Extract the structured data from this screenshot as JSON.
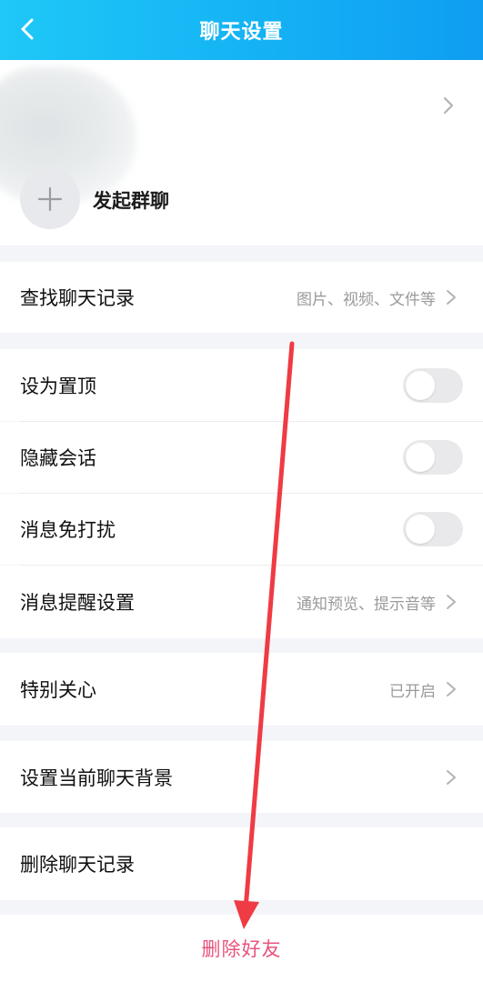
{
  "header": {
    "title": "聊天设置"
  },
  "profile": {
    "start_group_label": "发起群聊"
  },
  "search_history": {
    "label": "查找聊天记录",
    "value": "图片、视频、文件等"
  },
  "toggles": [
    {
      "label": "设为置顶",
      "enabled": false
    },
    {
      "label": "隐藏会话",
      "enabled": false
    },
    {
      "label": "消息免打扰",
      "enabled": false
    }
  ],
  "notification_settings": {
    "label": "消息提醒设置",
    "value": "通知预览、提示音等"
  },
  "special_care": {
    "label": "特别关心",
    "value": "已开启"
  },
  "chat_background": {
    "label": "设置当前聊天背景"
  },
  "delete_history": {
    "label": "删除聊天记录"
  },
  "delete_friend": {
    "label": "删除好友"
  },
  "colors": {
    "header_gradient_start": "#1fc8f7",
    "header_gradient_end": "#0f9df2",
    "danger_text": "#e9547d",
    "annotation_arrow": "#ef3b44"
  }
}
